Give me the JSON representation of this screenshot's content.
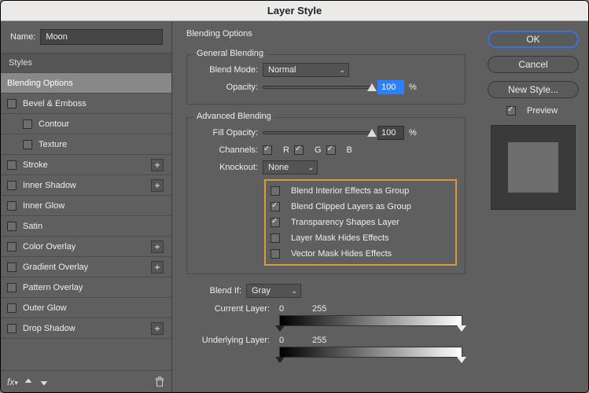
{
  "window": {
    "title": "Layer Style"
  },
  "name_field": {
    "label": "Name:",
    "value": "Moon"
  },
  "styles": {
    "header": "Styles",
    "items": [
      {
        "label": "Blending Options",
        "selected": true,
        "checkbox": false
      },
      {
        "label": "Bevel & Emboss",
        "checkbox": true,
        "checked": false
      },
      {
        "label": "Contour",
        "checkbox": true,
        "checked": false,
        "sub": true
      },
      {
        "label": "Texture",
        "checkbox": true,
        "checked": false,
        "sub": true
      },
      {
        "label": "Stroke",
        "checkbox": true,
        "checked": false,
        "plus": true
      },
      {
        "label": "Inner Shadow",
        "checkbox": true,
        "checked": false,
        "plus": true
      },
      {
        "label": "Inner Glow",
        "checkbox": true,
        "checked": false
      },
      {
        "label": "Satin",
        "checkbox": true,
        "checked": false
      },
      {
        "label": "Color Overlay",
        "checkbox": true,
        "checked": false,
        "plus": true
      },
      {
        "label": "Gradient Overlay",
        "checkbox": true,
        "checked": false,
        "plus": true
      },
      {
        "label": "Pattern Overlay",
        "checkbox": true,
        "checked": false
      },
      {
        "label": "Outer Glow",
        "checkbox": true,
        "checked": false
      },
      {
        "label": "Drop Shadow",
        "checkbox": true,
        "checked": false,
        "plus": true
      }
    ]
  },
  "blending": {
    "title": "Blending Options",
    "general": {
      "legend": "General Blending",
      "blend_mode": {
        "label": "Blend Mode:",
        "value": "Normal"
      },
      "opacity": {
        "label": "Opacity:",
        "value": "100",
        "unit": "%",
        "pos": 100
      }
    },
    "advanced": {
      "legend": "Advanced Blending",
      "fill_opacity": {
        "label": "Fill Opacity:",
        "value": "100",
        "unit": "%",
        "pos": 100
      },
      "channels": {
        "label": "Channels:",
        "r": {
          "label": "R",
          "checked": true
        },
        "g": {
          "label": "G",
          "checked": true
        },
        "b": {
          "label": "B",
          "checked": true
        }
      },
      "knockout": {
        "label": "Knockout:",
        "value": "None"
      },
      "options": [
        {
          "label": "Blend Interior Effects as Group",
          "checked": false
        },
        {
          "label": "Blend Clipped Layers as Group",
          "checked": true
        },
        {
          "label": "Transparency Shapes Layer",
          "checked": true
        },
        {
          "label": "Layer Mask Hides Effects",
          "checked": false
        },
        {
          "label": "Vector Mask Hides Effects",
          "checked": false
        }
      ]
    },
    "blendif": {
      "label": "Blend If:",
      "value": "Gray",
      "current_layer": {
        "label": "Current Layer:",
        "low": "0",
        "high": "255"
      },
      "underlying_layer": {
        "label": "Underlying Layer:",
        "low": "0",
        "high": "255"
      }
    }
  },
  "right": {
    "ok": "OK",
    "cancel": "Cancel",
    "new_style": "New Style...",
    "preview": "Preview"
  }
}
